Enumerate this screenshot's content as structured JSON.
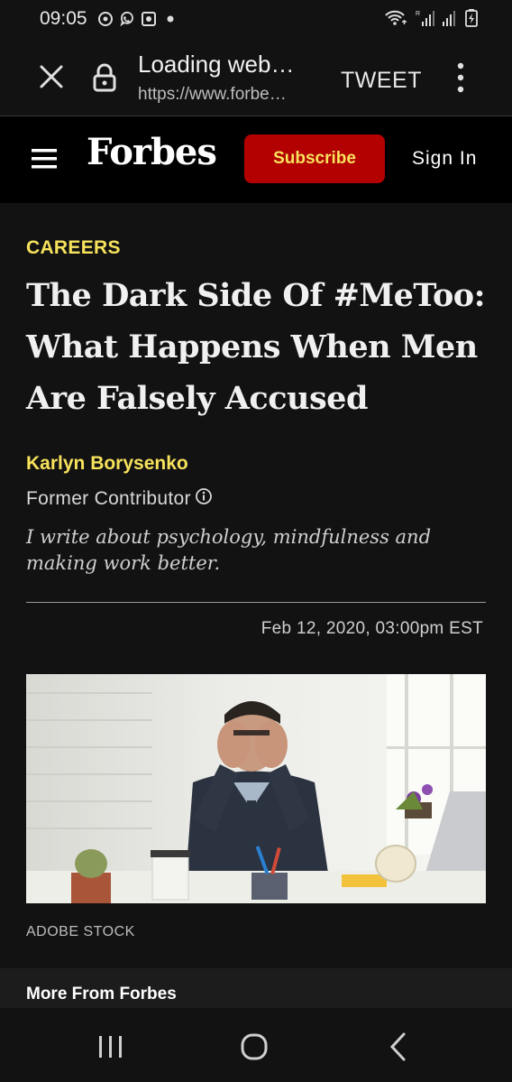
{
  "status_bar": {
    "time": "09:05",
    "icons": [
      "camera-app-icon",
      "viber-icon",
      "gallery-icon",
      "dot-icon"
    ],
    "right_icons": [
      "wifi-icon",
      "signal-icon",
      "signal-icon-2",
      "battery-icon"
    ]
  },
  "browser": {
    "title": "Loading web…",
    "url": "https://www.forbe…",
    "tweet_label": "TWEET"
  },
  "forbes_header": {
    "logo": "Forbes",
    "subscribe_label": "Subscribe",
    "signin_label": "Sign In",
    "colors": {
      "subscribe_bg": "#b30000",
      "subscribe_text": "#f7e25c",
      "accent": "#f7e25c"
    }
  },
  "article": {
    "category": "CAREERS",
    "headline": "The Dark Side Of #MeToo: What Happens When Men Are Falsely Accused",
    "author": "Karlyn Borysenko",
    "contributor_label": "Former Contributor",
    "bio": "I write about psychology, mindfulness and making work better.",
    "date": "Feb 12, 2020,  03:00pm EST",
    "image_credit": "ADOBE STOCK"
  },
  "more_from": {
    "label": "More From Forbes"
  },
  "nav_bar": {
    "buttons": [
      "recent-apps",
      "home",
      "back"
    ]
  }
}
